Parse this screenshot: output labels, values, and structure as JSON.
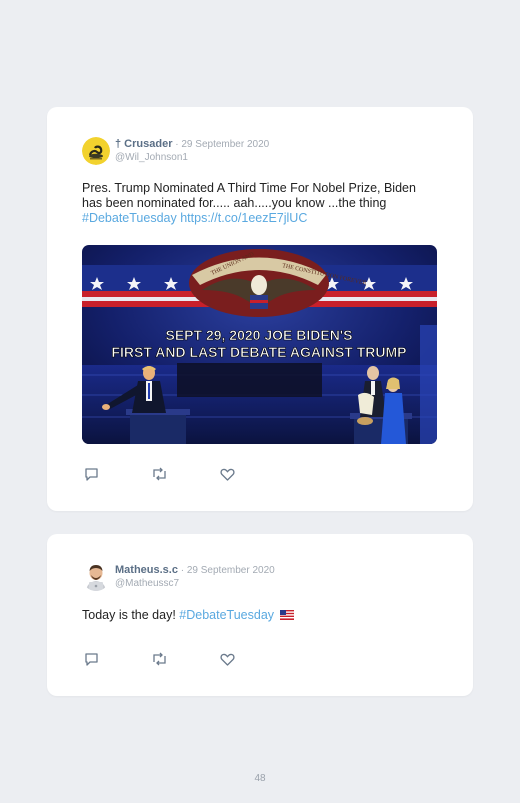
{
  "tweets": [
    {
      "name": "† Crusader",
      "separator": " · ",
      "date": "29 September 2020",
      "handle": "@Wil_Johnson1",
      "text": "Pres. Trump Nominated A Third Time For Nobel Prize, Biden has been nominated for..... aah.....you know ...the thing ",
      "hashtag": "#DebateTuesday",
      "link": " https://t.co/1eezE7jlUC",
      "avatar_icon": "gadsden-flag-avatar",
      "media": {
        "banner_top": "THE UNION AND",
        "banner_right": "THE CONSTITUTION FOREVER",
        "headline_1": "SEPT 29, 2020 JOE BIDEN'S",
        "headline_2": "FIRST AND LAST DEBATE AGAINST TRUMP"
      }
    },
    {
      "name": "Matheus.s.c",
      "separator": " · ",
      "date": "29 September 2020",
      "handle": "@Matheussc7",
      "text": "Today is the day! ",
      "hashtag": "#DebateTuesday",
      "emoji": "us-flag",
      "avatar_icon": "memoji-laptop-avatar"
    }
  ],
  "actions": [
    "reply-icon",
    "retweet-icon",
    "like-icon"
  ],
  "page_number": "48",
  "colors": {
    "name": "#5b6f86",
    "link": "#5aa9e0",
    "muted": "#a3aab3",
    "background": "#eceef2"
  }
}
